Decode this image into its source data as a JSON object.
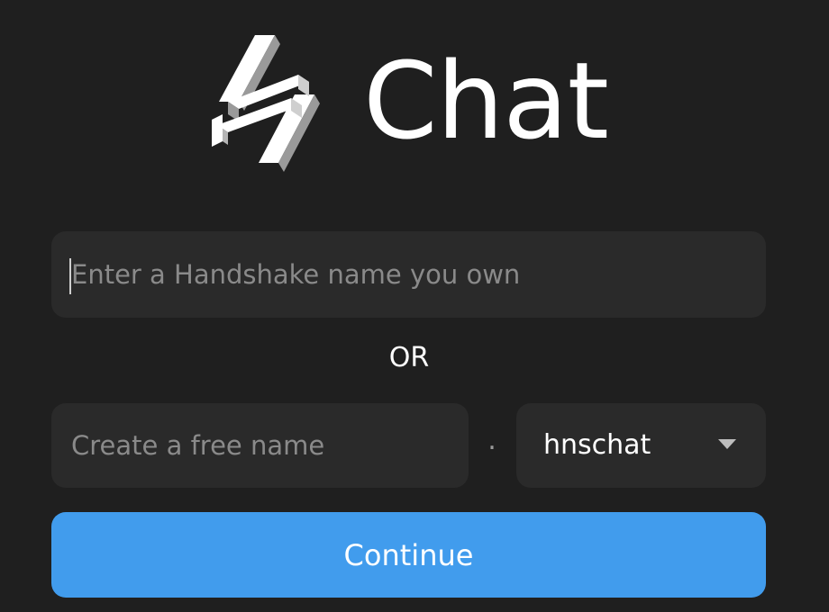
{
  "app": {
    "title": "Chat",
    "logo_icon": "hns-logo-icon"
  },
  "login": {
    "owned_name_placeholder": "Enter a Handshake name you own",
    "or_label": "OR",
    "free_name_placeholder": "Create a free name",
    "separator": ".",
    "domain_select": {
      "selected": "hnschat",
      "arrow_icon": "caret-down-icon"
    },
    "continue_label": "Continue"
  },
  "colors": {
    "background": "#1f1f1f",
    "field_background": "#2a2a2a",
    "accent": "#419ced",
    "text": "#ffffff",
    "placeholder": "#8a8a8a"
  }
}
